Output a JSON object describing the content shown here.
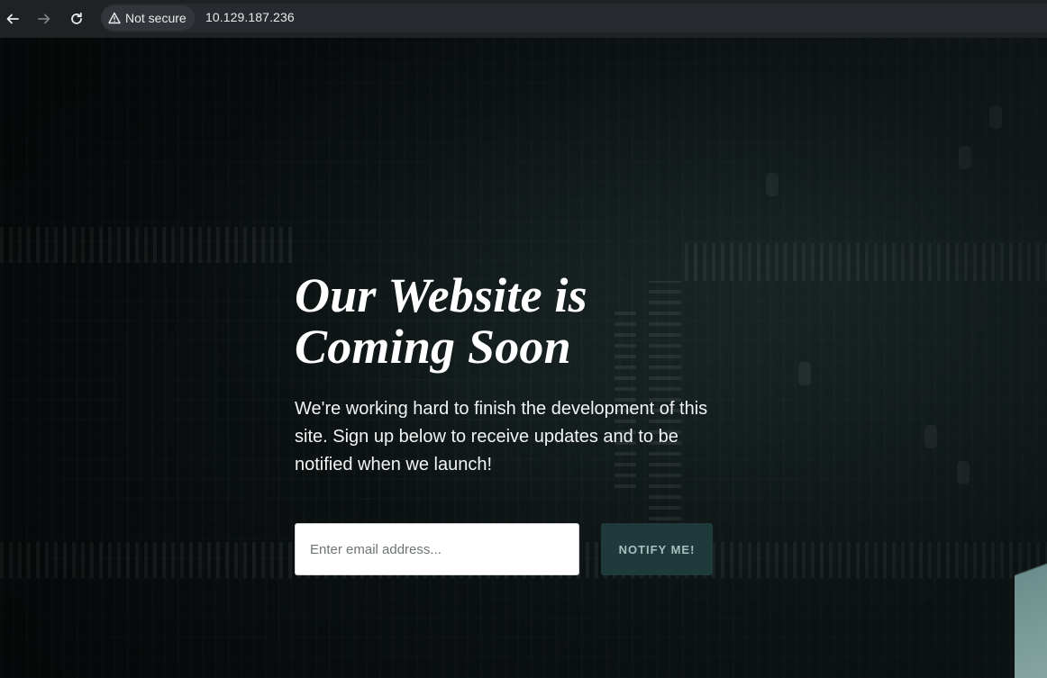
{
  "browser": {
    "back_icon": "back-arrow-icon",
    "forward_icon": "forward-arrow-icon",
    "reload_icon": "reload-icon",
    "security_label": "Not secure",
    "security_icon": "warning-triangle-icon",
    "url": "10.129.187.236"
  },
  "hero": {
    "title": "Our Website is Coming Soon",
    "subtitle": "We're working hard to finish the development of this site. Sign up below to receive updates and to be notified when we launch!",
    "email_placeholder": "Enter email address...",
    "notify_label": "NOTIFY ME!"
  },
  "colors": {
    "background": "#0c1314",
    "button_bg": "#1f3a3b",
    "button_text": "#a9bfbf",
    "title": "#ffffff"
  }
}
